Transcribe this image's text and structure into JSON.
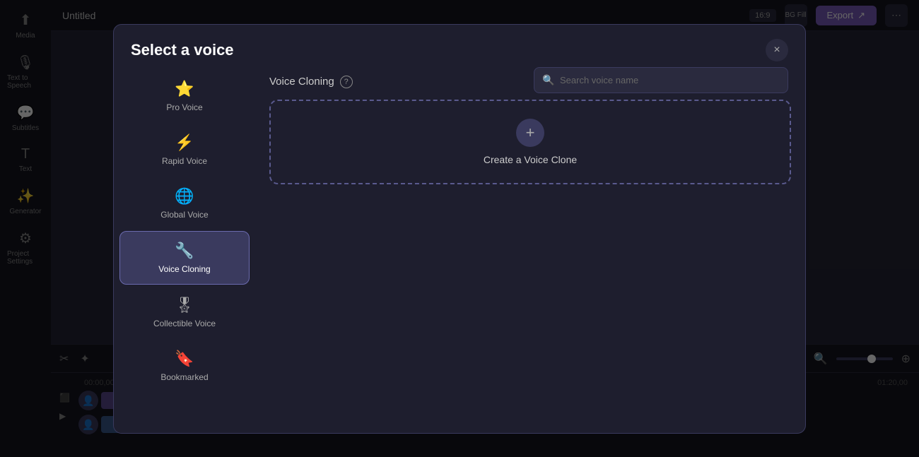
{
  "app": {
    "title": "Untitled",
    "aspect_ratio": "16:9",
    "bg_fill": "BG Fill",
    "export_label": "Export"
  },
  "sidebar": {
    "items": [
      {
        "id": "media",
        "label": "Media",
        "icon": "⬆"
      },
      {
        "id": "text-to-speech",
        "label": "Text to Speech",
        "icon": "🎙"
      },
      {
        "id": "subtitles",
        "label": "Subtitles",
        "icon": "💬"
      },
      {
        "id": "text",
        "label": "Text",
        "icon": "T"
      },
      {
        "id": "generator",
        "label": "Generator",
        "icon": "✨"
      },
      {
        "id": "project-settings",
        "label": "Project Settings",
        "icon": "⚙"
      }
    ]
  },
  "modal": {
    "title": "Select a voice",
    "close_label": "×",
    "search_placeholder": "Search voice name",
    "section_title": "Voice Cloning",
    "help_tooltip": "?",
    "create_clone_label": "Create a Voice Clone",
    "voice_categories": [
      {
        "id": "pro-voice",
        "label": "Pro Voice",
        "icon": "⭐"
      },
      {
        "id": "rapid-voice",
        "label": "Rapid Voice",
        "icon": "⚡"
      },
      {
        "id": "global-voice",
        "label": "Global Voice",
        "icon": "🌐"
      },
      {
        "id": "voice-cloning",
        "label": "Voice Cloning",
        "icon": "🔧",
        "active": true
      },
      {
        "id": "collectible-voice",
        "label": "Collectible Voice",
        "icon": "🎖"
      },
      {
        "id": "bookmarked",
        "label": "Bookmarked",
        "icon": "🔖"
      }
    ]
  },
  "topbar": {
    "title": "Untitled",
    "export": "Export"
  },
  "timeline": {
    "start_time": "00:00,00",
    "end_time": "01:20,00",
    "tracks": [
      {
        "color": "#6a5acd"
      },
      {
        "color": "#4a7acd"
      }
    ]
  }
}
